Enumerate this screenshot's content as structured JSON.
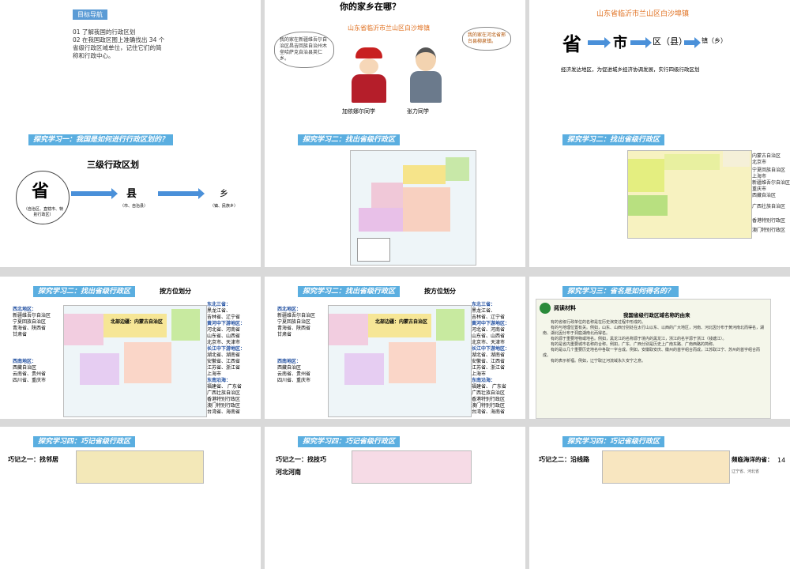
{
  "s1": {
    "tag": "目标导航",
    "lines": [
      "01 了解我国的行政区划",
      "02 在我国政区图上准确找出 34 个",
      "省级行政区域单位，记住它们的简",
      "称和行政中心。"
    ]
  },
  "s2": {
    "title": "你的家乡在哪？",
    "subtitle": "山东省临沂市兰山区白沙埠镇",
    "left_bubble": "我的家在新疆维吾尔自治区昌吉回族自治州木垒哈萨克自治县英仁乡。",
    "right_bubble": "我的家在河北省邢台县柳泉镇。",
    "left_name": "加依娜尔同学",
    "right_name": "张力同学"
  },
  "s3": {
    "title": "山东省临沂市兰山区白沙埠镇",
    "l1": "省",
    "l2": "市",
    "l3": "区（县）",
    "l4": "镇（乡）",
    "note": "经济发达地区，为促进城乡经济协调发展，实行四级行政区划"
  },
  "s4": {
    "header": "探究学习一：我国是如何进行行政区划的？",
    "title": "三级行政区划",
    "p": "省",
    "p_sub": "（自治区、直辖市、特别行政区）",
    "c": "县",
    "c_sub": "（市、自治县）",
    "t": "乡",
    "t_sub": "（镇、民族乡）"
  },
  "s5": {
    "header": "探究学习二：找出省级行政区"
  },
  "s6": {
    "header": "探究学习二：找出省级行政区",
    "labels": [
      "内蒙古自治区",
      "北京市",
      "宁夏回族自治区",
      "上海市",
      "新疆维吾尔自治区",
      "重庆市",
      "西藏自治区",
      "广西壮族自治区",
      "香港特别行政区",
      "澳门特别行政区"
    ]
  },
  "s7": {
    "header": "探究学习二：找出省级行政区",
    "side": "按方位划分",
    "west_title": "西北地区：",
    "west": [
      "新疆维吾尔自治区",
      "宁夏回族自治区",
      "青海省、陕西省",
      "甘肃省"
    ],
    "sw_title": "西南地区：",
    "sw": [
      "西藏自治区",
      "云南省、贵州省",
      "四川省、重庆市"
    ],
    "north": "北部边疆：内蒙古自治区",
    "ne_title": "东北三省：",
    "ne": [
      "黑龙江省、",
      "吉林省、辽宁省"
    ],
    "hh_title": "黄河中下游地区：",
    "hh": [
      "河北省、河南省",
      "山东省、山西省",
      "北京市、天津市"
    ],
    "cj_title": "长江中下游地区：",
    "cj": [
      "湖北省、湖南省",
      "安徽省、江西省",
      "江苏省、浙江省",
      "上海市"
    ],
    "se_title": "东南沿海：",
    "se": [
      "福建省、 广东省",
      "广西壮族自治区",
      "香港特别行政区",
      "澳门特别行政区",
      "台湾省、海南省"
    ]
  },
  "s9": {
    "header": "探究学习三：省名是如何得名的？",
    "tag": "阅读材料",
    "title": "我国省级行政区域名称的由来",
    "paras": [
      "有的省级行政单位的名称是在历史演变过程中形成的。",
      "有的与地理位置有关。例如，山东、山西分别处在太行山以东、以西的广大地区，河南、河北因分布于黄河南北而得名，湖南、湖北因分布于洞庭湖南北而得名。",
      "有的源于重要地物或地名。例如，黑龙江的名称源于境内的黑龙江，浙江的名字源于浙江（钱塘江）。",
      "有的是省内重要城市名称的合称。例如，广东、广西分别是历史上广南东路、广南西路的简称。",
      "有的是以几个重要历史地名中各取一字合成。例如，安徽取安庆、徽州的首字组合而成，江苏取江宁、苏州的首字组合而成。",
      "有的表示祈福。例如，辽宁取辽河流域永久安宁之意。"
    ]
  },
  "s10": {
    "header": "探究学习四：巧记省级行政区",
    "tip": "巧记之一：找邻居"
  },
  "s11": {
    "header": "探究学习四：巧记省级行政区",
    "tip": "巧记之一：找技巧",
    "tip2": "河北河南"
  },
  "s12": {
    "header": "探究学习四：巧记省级行政区",
    "tip": "巧记之二：沿线路",
    "right": "频临海洋的省：",
    "page": "14",
    "more": "辽宁省、河北省"
  }
}
